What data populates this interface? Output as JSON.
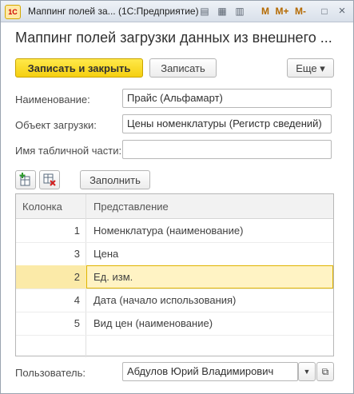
{
  "window": {
    "logo": "1С",
    "title": "Маппинг полей за... (1С:Предприятие)",
    "controls": [
      "M",
      "M+",
      "M-",
      "□",
      "×"
    ]
  },
  "form": {
    "heading": "Маппинг полей загрузки данных из внешнего ..."
  },
  "toolbar": {
    "save_close_label": "Записать и закрыть",
    "save_label": "Записать",
    "more_label": "Еще ▾"
  },
  "fields": {
    "name_label": "Наименование:",
    "name_value": "Прайс (Альфамарт)",
    "object_label": "Объект загрузки:",
    "object_value": "Цены номенклатуры (Регистр сведений)",
    "table_part_label": "Имя табличной части:",
    "table_part_value": ""
  },
  "table_toolbar": {
    "fill_label": "Заполнить"
  },
  "table": {
    "headers": [
      "Колонка",
      "Представление"
    ],
    "rows": [
      {
        "col": "1",
        "repr": "Номенклатура (наименование)"
      },
      {
        "col": "3",
        "repr": "Цена"
      },
      {
        "col": "2",
        "repr": "Ед. изм."
      },
      {
        "col": "4",
        "repr": "Дата (начало использования)"
      },
      {
        "col": "5",
        "repr": "Вид цен (наименование)"
      }
    ],
    "selected_row": 2
  },
  "user": {
    "label": "Пользователь:",
    "value": "Абдулов Юрий Владимирович"
  }
}
